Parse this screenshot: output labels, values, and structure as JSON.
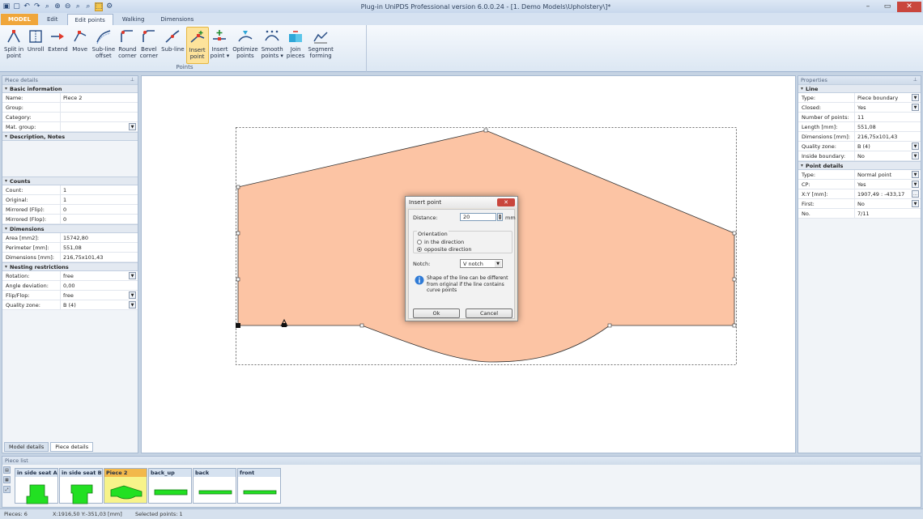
{
  "title": "Plug-in UniPDS Professional version 6.0.0.24 - [1. Demo Models\\Upholstery\\]*",
  "tabs": [
    "MODEL",
    "Edit",
    "Edit points",
    "Walking",
    "Dimensions"
  ],
  "ribbon": {
    "group_label": "Points",
    "buttons": [
      {
        "label": "Split in\npoint",
        "icon": "split-icon"
      },
      {
        "label": "Unroll",
        "icon": "unroll-icon"
      },
      {
        "label": "Extend",
        "icon": "extend-icon"
      },
      {
        "label": "Move",
        "icon": "move-icon"
      },
      {
        "label": "Sub-line\noffset",
        "icon": "offset-icon"
      },
      {
        "label": "Round\ncorner",
        "icon": "round-corner-icon"
      },
      {
        "label": "Bevel\ncorner",
        "icon": "bevel-corner-icon"
      },
      {
        "label": "Sub-line",
        "icon": "sub-line-icon"
      },
      {
        "label": "Insert\npoint",
        "icon": "insert-point-icon",
        "selected": true
      },
      {
        "label": "Insert\npoint ▾",
        "icon": "insert-point-menu-icon"
      },
      {
        "label": "Optimize\npoints",
        "icon": "optimize-icon"
      },
      {
        "label": "Smooth\npoints ▾",
        "icon": "smooth-icon"
      },
      {
        "label": "Join\npieces",
        "icon": "join-icon"
      },
      {
        "label": "Segment\nforming",
        "icon": "segment-icon"
      }
    ]
  },
  "left_panel": {
    "title": "Piece details",
    "sections": [
      {
        "name": "Basic information",
        "rows": [
          {
            "k": "Name:",
            "v": "Piece 2"
          },
          {
            "k": "Group:",
            "v": ""
          },
          {
            "k": "Category:",
            "v": ""
          },
          {
            "k": "Mat. group:",
            "v": "",
            "dd": true
          }
        ]
      },
      {
        "name": "Description, Notes",
        "rows": [],
        "blank": true
      },
      {
        "name": "Counts",
        "rows": [
          {
            "k": "Count:",
            "v": "1"
          },
          {
            "k": "Original:",
            "v": "1"
          },
          {
            "k": "Mirrored (Flip):",
            "v": "0"
          },
          {
            "k": "Mirrored (Flop):",
            "v": "0"
          }
        ]
      },
      {
        "name": "Dimensions",
        "rows": [
          {
            "k": "Area [mm2]:",
            "v": "15742,80"
          },
          {
            "k": "Perimeter [mm]:",
            "v": "551,08"
          },
          {
            "k": "Dimensions [mm]:",
            "v": "216,75x101,43"
          }
        ]
      },
      {
        "name": "Nesting restrictions",
        "rows": [
          {
            "k": "Rotation:",
            "v": "free",
            "dd": true
          },
          {
            "k": "Angle deviation:",
            "v": "0,00"
          },
          {
            "k": "Flip/Flop:",
            "v": "free",
            "dd": true
          },
          {
            "k": "Quality zone:",
            "v": "B (4)",
            "dd": true
          }
        ]
      }
    ],
    "bottom_tabs": [
      "Model details",
      "Piece details"
    ]
  },
  "right_panel": {
    "title": "Properties",
    "sections": [
      {
        "name": "Line",
        "rows": [
          {
            "k": "Type:",
            "v": "Piece boundary",
            "dd": true
          },
          {
            "k": "Closed:",
            "v": "Yes",
            "dd": true
          },
          {
            "k": "Number of points:",
            "v": "11"
          },
          {
            "k": "Length [mm]:",
            "v": "551,08"
          },
          {
            "k": "Dimensions [mm]:",
            "v": "216,75x101,43"
          },
          {
            "k": "Quality zone:",
            "v": "B (4)",
            "dd": true
          },
          {
            "k": "Inside boundary:",
            "v": "No",
            "dd": true
          }
        ]
      },
      {
        "name": "Point details",
        "rows": [
          {
            "k": "Type:",
            "v": "Normal point",
            "dd": true
          },
          {
            "k": "CP:",
            "v": "Yes",
            "dd": true
          },
          {
            "k": "X:Y [mm]:",
            "v": "1907,49 : -433,17",
            "dd": true,
            "ddlabel": "..."
          },
          {
            "k": "First:",
            "v": "No",
            "dd": true
          },
          {
            "k": "No.",
            "v": "7/11"
          }
        ]
      }
    ]
  },
  "dialog": {
    "title": "Insert point",
    "distance_label": "Distance:",
    "distance_value": "20",
    "unit": "mm",
    "orientation_label": "Orientation",
    "opt1": "in the direction",
    "opt2": "opposite direction",
    "notch_label": "Notch:",
    "notch_value": "V notch",
    "info": "Shape of the line can be different from original if the line contains curve points",
    "ok": "Ok",
    "cancel": "Cancel"
  },
  "piece_list": {
    "title": "Piece list",
    "items": [
      {
        "name": "in side seat A",
        "shape": "seat-a"
      },
      {
        "name": "in side seat B",
        "shape": "seat-b"
      },
      {
        "name": "Piece 2",
        "shape": "piece2",
        "selected": true
      },
      {
        "name": "back_up",
        "shape": "bar"
      },
      {
        "name": "back",
        "shape": "bar-thin"
      },
      {
        "name": "front",
        "shape": "bar-thin"
      }
    ]
  },
  "status": {
    "pieces": "Pieces: 6",
    "coords": "X:1916,50  Y:-351,03 [mm]",
    "selected": "Selected points: 1"
  },
  "colors": {
    "piece_fill": "#fcc4a4",
    "thumb_fill": "#22e022",
    "accent": "#f0a63a"
  }
}
